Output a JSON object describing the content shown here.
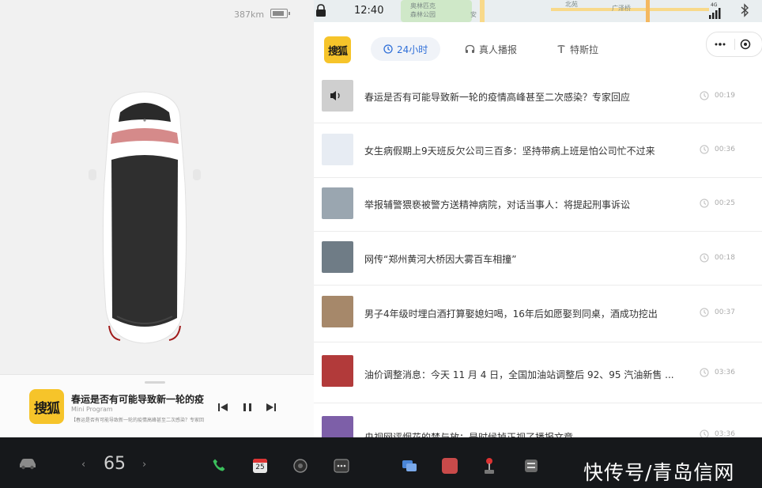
{
  "status": {
    "range": "387km",
    "time": "12:40",
    "network": "4G",
    "battery_level": 0.85
  },
  "map_labels": [
    "奥林匹克",
    "森林公园",
    "安",
    "广泽桥",
    "北苑"
  ],
  "music": {
    "logo_text": "搜狐",
    "title": "春运是否有可能导致新一轮的疫情",
    "subtitle": "Mini Program",
    "detail": "【春运是否有可能导致新一轮的疫情高峰甚至二次感染？专家回应】"
  },
  "header": {
    "logo_text": "搜狐",
    "tabs": [
      {
        "label": "24小时",
        "icon": "clock-icon",
        "active": true
      },
      {
        "label": "真人播报",
        "icon": "headphones-icon",
        "active": false
      },
      {
        "label": "特斯拉",
        "icon": "tesla-icon",
        "active": false
      }
    ]
  },
  "news": [
    {
      "headline": "春运是否有可能导致新一轮的疫情高峰甚至二次感染？专家回应",
      "duration": "00:19",
      "thumb": "#cfcfcf"
    },
    {
      "headline": "女生病假期上9天班反欠公司三百多：坚持带病上班是怕公司忙不过来",
      "duration": "00:36",
      "thumb": "#e7ecf3"
    },
    {
      "headline": "举报辅警猥亵被警方送精神病院，对话当事人：将提起刑事诉讼",
      "duration": "00:25",
      "thumb": "#9aa6b0"
    },
    {
      "headline": "网传“郑州黄河大桥因大雾百车相撞”",
      "duration": "00:18",
      "thumb": "#6f7c86"
    },
    {
      "headline": "男子4年级时埋白酒打算娶媳妇喝，16年后如愿娶到同桌，酒成功挖出",
      "duration": "00:37",
      "thumb": "#a6886a"
    },
    {
      "headline": "油价调整消息：今天 11 月 4 日，全国加油站调整后 92、95 汽油新售 ...",
      "duration": "03:36",
      "thumb": "#b23a3a"
    },
    {
      "headline": "央视网评烟花的禁与放：是时候掉正视了播报文章",
      "duration": "03:36",
      "thumb": "#7d5fa8"
    }
  ],
  "taskbar": {
    "temperature": "65",
    "calendar_day": "25"
  },
  "watermark": "快传号/青岛信网",
  "colors": {
    "accent": "#2f6fd8",
    "logo_yellow": "#f6c42a",
    "taskbar": "#16181b",
    "phone_green": "#3bbf5c"
  }
}
